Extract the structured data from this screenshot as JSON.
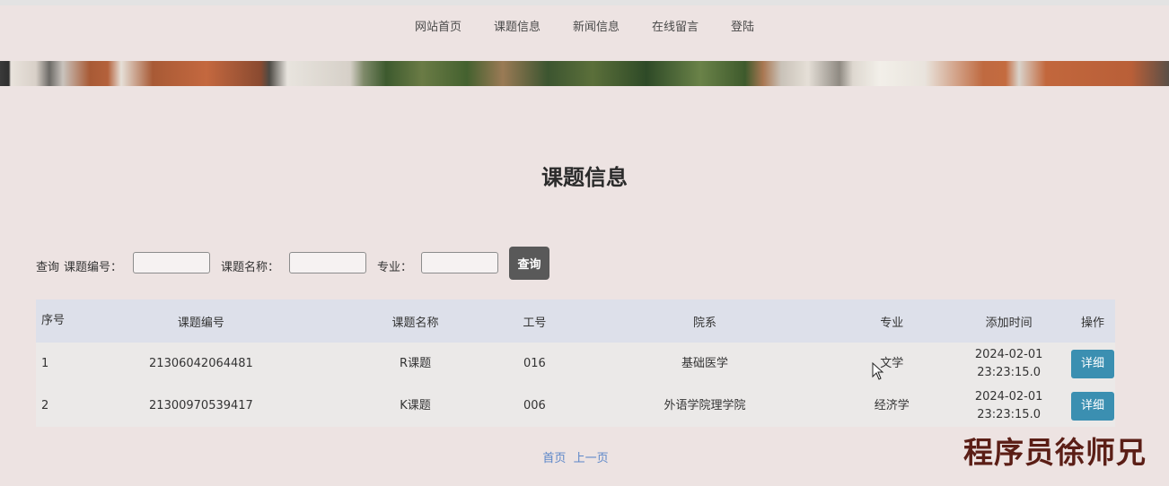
{
  "nav": {
    "items": [
      "网站首页",
      "课题信息",
      "新闻信息",
      "在线留言",
      "登陆"
    ]
  },
  "page": {
    "title": "课题信息"
  },
  "search": {
    "prefix": "查询",
    "field1_label": "课题编号：",
    "field2_label": "课题名称：",
    "field3_label": "专业：",
    "button_label": "查询"
  },
  "table": {
    "headers": [
      "序号",
      "课题编号",
      "课题名称",
      "工号",
      "院系",
      "专业",
      "添加时间",
      "操作"
    ],
    "rows": [
      {
        "index": "1",
        "code": "21306042064481",
        "name": "R课题",
        "job_no": "016",
        "dept": "基础医学",
        "major": "文学",
        "date": "2024-02-01",
        "time": "23:23:15.0",
        "action": "详细"
      },
      {
        "index": "2",
        "code": "21300970539417",
        "name": "K课题",
        "job_no": "006",
        "dept": "外语学院理学院",
        "major": "经济学",
        "date": "2024-02-01",
        "time": "23:23:15.0",
        "action": "详细"
      }
    ]
  },
  "pager": {
    "first": "首页",
    "prev": "上一页"
  },
  "watermark": "程序员徐师兄",
  "colors": {
    "background": "#ede3e2",
    "header_row": "#dde0ea",
    "detail_button": "#3b8fb1",
    "search_button": "#595959",
    "pager_link": "#5b86c8"
  }
}
